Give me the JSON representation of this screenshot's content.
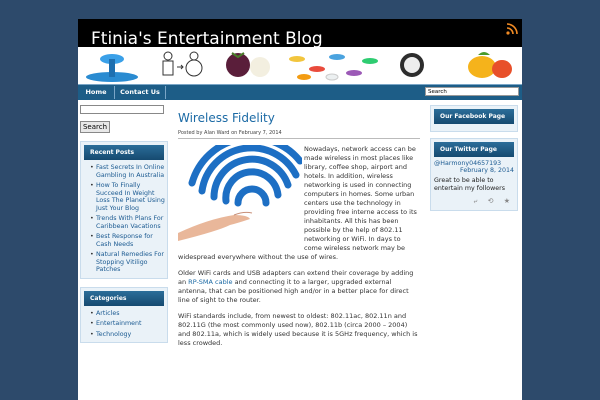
{
  "header": {
    "title": "Ftinia's Entertainment Blog",
    "rss_icon": "rss-icon"
  },
  "nav": {
    "items": [
      {
        "label": "Home"
      },
      {
        "label": "Contact Us"
      }
    ],
    "search_placeholder": "Search"
  },
  "sidebar_left": {
    "search_button": "Search",
    "recent_posts": {
      "title": "Recent Posts",
      "items": [
        {
          "label": "Fast Secrets In Online Gambling In Australia"
        },
        {
          "label": "How To Finally Succeed In Weight Loss The Planet Using Just Your Blog"
        },
        {
          "label": "Trends With Plans For Caribbean Vacations"
        },
        {
          "label": "Best Response for Cash Needs"
        },
        {
          "label": "Natural Remedies For Stopping Vitiligo Patches"
        }
      ]
    },
    "categories": {
      "title": "Categories",
      "items": [
        {
          "label": "Articles"
        },
        {
          "label": "Entertainment"
        },
        {
          "label": "Technology"
        }
      ]
    }
  },
  "post": {
    "title": "Wireless Fidelity",
    "meta": "Posted by Alan Ward on February 7, 2014",
    "p1": "Nowadays, network access can be made wireless in most places like library, coffee shop, airport and hotels. In addition, wireless networking is used in connecting computers in homes. Some urban centers use the technology in providing free interne access to its inhabitants. All this has been possible by the help of 802.11 networking or WiFi. In days to come wireless network may be widespread everywhere without the use of wires.",
    "p2_before": "Older WiFi cards and USB adapters can extend their coverage by adding an ",
    "p2_link": "RP-SMA cable",
    "p2_after": " and connecting it to a larger, upgraded external antenna, that can be positioned high and/or in a better place for direct line of sight to the router.",
    "p3": "WiFi standards include, from newest to oldest: 802.11ac, 802.11n and 802.11G (the most commonly used now), 802.11b (circa 2000 – 2004) and 802.11a, which is widely used because it is 5GHz frequency, which is less crowded."
  },
  "sidebar_right": {
    "facebook_title": "Our Facebook Page",
    "twitter": {
      "title": "Our Twitter Page",
      "handle": "@Harmony04657193",
      "date": "February 8, 2014",
      "text": "Great to be able to entertain my followers",
      "actions": "⤶ ⟲ ★"
    }
  },
  "colors": {
    "accent": "#1b6aa5",
    "nav_bg": "#1d5d87",
    "page_bg": "#2d4a6b"
  }
}
